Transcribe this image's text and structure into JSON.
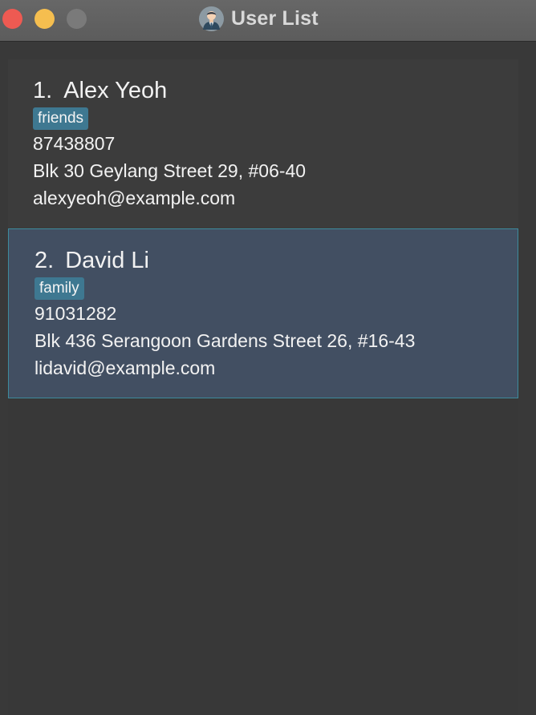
{
  "window": {
    "title": "User List",
    "app_icon": "user-avatar-icon",
    "controls": [
      "close",
      "minimize",
      "zoom"
    ],
    "colors": {
      "close": "#ee5a52",
      "minimize": "#f5be4f",
      "zoom": "#7a7a7a",
      "background": "#393939",
      "selected_card": "#424f62",
      "selected_border": "#3d8b9d",
      "tag": "#3e7891"
    }
  },
  "users": [
    {
      "index": "1.",
      "name": "Alex Yeoh",
      "tag": "friends",
      "phone": "87438807",
      "address": "Blk 30 Geylang Street 29, #06-40",
      "email": "alexyeoh@example.com",
      "selected": false
    },
    {
      "index": "2.",
      "name": "David Li",
      "tag": "family",
      "phone": "91031282",
      "address": "Blk 436 Serangoon Gardens Street 26, #16-43",
      "email": "lidavid@example.com",
      "selected": true
    }
  ]
}
